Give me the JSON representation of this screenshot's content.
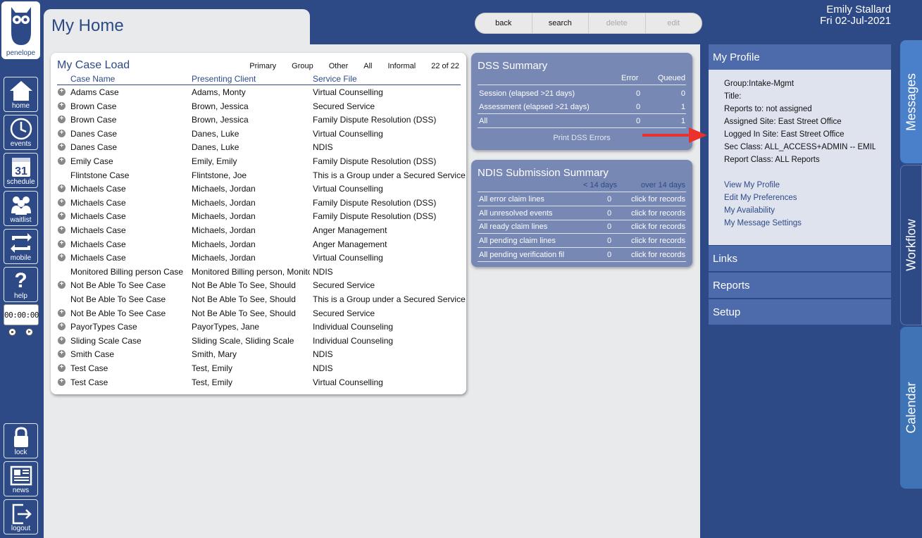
{
  "logo": {
    "text": "penelope"
  },
  "nav": [
    {
      "label": "home",
      "icon": "home-icon"
    },
    {
      "label": "events",
      "icon": "clock-icon"
    },
    {
      "label": "schedule",
      "icon": "calendar-icon",
      "day": "31"
    },
    {
      "label": "waitlist",
      "icon": "people-icon"
    },
    {
      "label": "mobile",
      "icon": "sync-icon"
    },
    {
      "label": "help",
      "icon": "question-icon"
    }
  ],
  "nav_bottom": [
    {
      "label": "lock",
      "icon": "lock-icon"
    },
    {
      "label": "news",
      "icon": "newspaper-icon"
    },
    {
      "label": "logout",
      "icon": "logout-icon"
    }
  ],
  "timer": "00:00:00",
  "page_title": "My Home",
  "actions": {
    "back": "back",
    "search": "search",
    "delete": "delete",
    "edit": "edit"
  },
  "user": {
    "name": "Emily Stallard",
    "date": "Fri 02-Jul-2021"
  },
  "caseload": {
    "title": "My Case Load",
    "filters": [
      "Primary",
      "Group",
      "Other",
      "All",
      "Informal"
    ],
    "count": "22 of 22",
    "headers": [
      "Case Name",
      "Presenting Client",
      "Service File"
    ],
    "rows": [
      {
        "case": "Adams Case",
        "client": "Adams, Monty",
        "service": "Virtual Counselling",
        "plus": true
      },
      {
        "case": "Brown Case",
        "client": "Brown, Jessica",
        "service": "Secured Service",
        "plus": true
      },
      {
        "case": "Brown Case",
        "client": "Brown, Jessica",
        "service": "Family Dispute Resolution (DSS)",
        "plus": true
      },
      {
        "case": "Danes Case",
        "client": "Danes, Luke",
        "service": "Virtual Counselling",
        "plus": true
      },
      {
        "case": "Danes Case",
        "client": "Danes, Luke",
        "service": "NDIS",
        "plus": true
      },
      {
        "case": "Emily Case",
        "client": "Emily, Emily",
        "service": "Family Dispute Resolution (DSS)",
        "plus": true
      },
      {
        "case": "Flintstone Case",
        "client": "Flintstone, Joe",
        "service": "This is a Group under a Secured Service",
        "plus": false
      },
      {
        "case": "Michaels Case",
        "client": "Michaels, Jordan",
        "service": "Virtual Counselling",
        "plus": true
      },
      {
        "case": "Michaels Case",
        "client": "Michaels, Jordan",
        "service": "Family Dispute Resolution (DSS)",
        "plus": true
      },
      {
        "case": "Michaels Case",
        "client": "Michaels, Jordan",
        "service": "Family Dispute Resolution (DSS)",
        "plus": true
      },
      {
        "case": "Michaels Case",
        "client": "Michaels, Jordan",
        "service": "Anger Management",
        "plus": true
      },
      {
        "case": "Michaels Case",
        "client": "Michaels, Jordan",
        "service": "Anger Management",
        "plus": true
      },
      {
        "case": "Michaels Case",
        "client": "Michaels, Jordan",
        "service": "Virtual Counselling",
        "plus": true
      },
      {
        "case": "Monitored Billing person Case",
        "client": "Monitored Billing person, Monitored",
        "service": "NDIS",
        "plus": false
      },
      {
        "case": "Not Be Able To See Case",
        "client": "Not Be Able To See, Should",
        "service": "Secured Service",
        "plus": true
      },
      {
        "case": "Not Be Able To See Case",
        "client": "Not Be Able To See, Should",
        "service": "This is a Group under a Secured Service",
        "plus": false
      },
      {
        "case": "Not Be Able To See Case",
        "client": "Not Be Able To See, Should",
        "service": "Secured Service",
        "plus": true
      },
      {
        "case": "PayorTypes Case",
        "client": "PayorTypes, Jane",
        "service": "Individual Counseling",
        "plus": true
      },
      {
        "case": "Sliding Scale Case",
        "client": "Sliding Scale, Sliding Scale",
        "service": "Individual Counseling",
        "plus": true
      },
      {
        "case": "Smith Case",
        "client": "Smith, Mary",
        "service": "NDIS",
        "plus": true
      },
      {
        "case": "Test Case",
        "client": "Test, Emily",
        "service": "NDIS",
        "plus": true
      },
      {
        "case": "Test Case",
        "client": "Test, Emily",
        "service": "Virtual Counselling",
        "plus": true
      }
    ]
  },
  "dss": {
    "title": "DSS Summary",
    "headers": [
      "Error",
      "Queued"
    ],
    "rows": [
      {
        "label": "Session (elapsed >21 days)",
        "error": "0",
        "queued": "0"
      },
      {
        "label": "Assessment (elapsed >21 days)",
        "error": "0",
        "queued": "1"
      },
      {
        "label": "All",
        "error": "0",
        "queued": "1"
      }
    ],
    "print": "Print DSS Errors"
  },
  "ndis": {
    "title": "NDIS Submission Summary",
    "headers": [
      "< 14 days",
      "over 14 days"
    ],
    "rows": [
      {
        "label": "All error claim lines",
        "count": "0",
        "link": "click for records"
      },
      {
        "label": "All unresolved events",
        "count": "0",
        "link": "click for records"
      },
      {
        "label": "All ready claim lines",
        "count": "0",
        "link": "click for records"
      },
      {
        "label": "All pending claim lines",
        "count": "0",
        "link": "click for records"
      },
      {
        "label": "All pending verification fil",
        "count": "0",
        "link": "click for records"
      }
    ]
  },
  "profile": {
    "title": "My Profile",
    "lines": [
      "Group:Intake-Mgmt",
      "Title:",
      "Reports to: not assigned",
      "Assigned Site: East Street Office",
      "Logged In Site: East Street Office",
      "Sec Class: ALL_ACCESS+ADMIN -- EMILY",
      "Report Class: ALL Reports"
    ],
    "links": [
      "View My Profile",
      "Edit My Preferences",
      "My Availability",
      "My Message Settings"
    ]
  },
  "sections": [
    "Links",
    "Reports",
    "Setup"
  ],
  "vtabs": [
    "Messages",
    "Workflow",
    "Calendar"
  ],
  "colors": {
    "brand": "#2d4a87",
    "panel": "#7888b4",
    "accent_arrow": "#e8322b"
  }
}
